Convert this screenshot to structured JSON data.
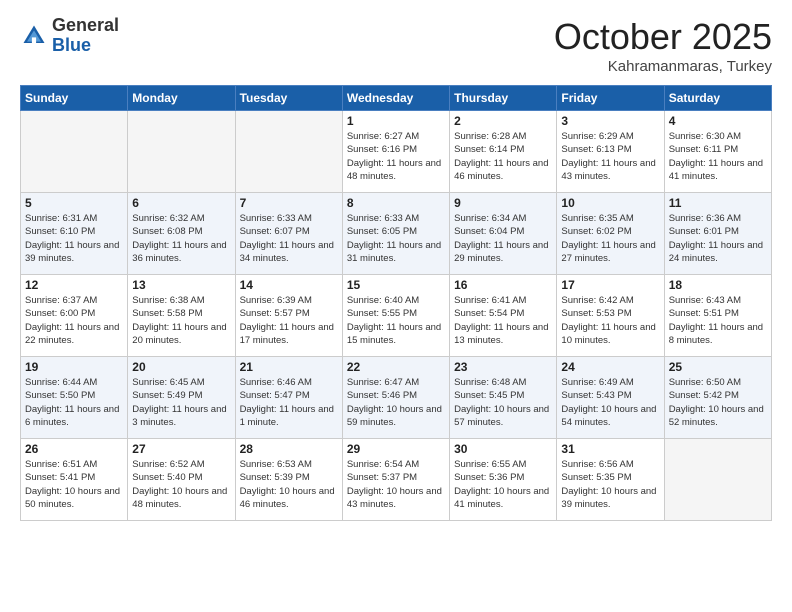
{
  "header": {
    "logo_general": "General",
    "logo_blue": "Blue",
    "month": "October 2025",
    "location": "Kahramanmaras, Turkey"
  },
  "weekdays": [
    "Sunday",
    "Monday",
    "Tuesday",
    "Wednesday",
    "Thursday",
    "Friday",
    "Saturday"
  ],
  "weeks": [
    [
      {
        "day": "",
        "empty": true
      },
      {
        "day": "",
        "empty": true
      },
      {
        "day": "",
        "empty": true
      },
      {
        "day": "1",
        "sunrise": "Sunrise: 6:27 AM",
        "sunset": "Sunset: 6:16 PM",
        "daylight": "Daylight: 11 hours and 48 minutes."
      },
      {
        "day": "2",
        "sunrise": "Sunrise: 6:28 AM",
        "sunset": "Sunset: 6:14 PM",
        "daylight": "Daylight: 11 hours and 46 minutes."
      },
      {
        "day": "3",
        "sunrise": "Sunrise: 6:29 AM",
        "sunset": "Sunset: 6:13 PM",
        "daylight": "Daylight: 11 hours and 43 minutes."
      },
      {
        "day": "4",
        "sunrise": "Sunrise: 6:30 AM",
        "sunset": "Sunset: 6:11 PM",
        "daylight": "Daylight: 11 hours and 41 minutes."
      }
    ],
    [
      {
        "day": "5",
        "sunrise": "Sunrise: 6:31 AM",
        "sunset": "Sunset: 6:10 PM",
        "daylight": "Daylight: 11 hours and 39 minutes."
      },
      {
        "day": "6",
        "sunrise": "Sunrise: 6:32 AM",
        "sunset": "Sunset: 6:08 PM",
        "daylight": "Daylight: 11 hours and 36 minutes."
      },
      {
        "day": "7",
        "sunrise": "Sunrise: 6:33 AM",
        "sunset": "Sunset: 6:07 PM",
        "daylight": "Daylight: 11 hours and 34 minutes."
      },
      {
        "day": "8",
        "sunrise": "Sunrise: 6:33 AM",
        "sunset": "Sunset: 6:05 PM",
        "daylight": "Daylight: 11 hours and 31 minutes."
      },
      {
        "day": "9",
        "sunrise": "Sunrise: 6:34 AM",
        "sunset": "Sunset: 6:04 PM",
        "daylight": "Daylight: 11 hours and 29 minutes."
      },
      {
        "day": "10",
        "sunrise": "Sunrise: 6:35 AM",
        "sunset": "Sunset: 6:02 PM",
        "daylight": "Daylight: 11 hours and 27 minutes."
      },
      {
        "day": "11",
        "sunrise": "Sunrise: 6:36 AM",
        "sunset": "Sunset: 6:01 PM",
        "daylight": "Daylight: 11 hours and 24 minutes."
      }
    ],
    [
      {
        "day": "12",
        "sunrise": "Sunrise: 6:37 AM",
        "sunset": "Sunset: 6:00 PM",
        "daylight": "Daylight: 11 hours and 22 minutes."
      },
      {
        "day": "13",
        "sunrise": "Sunrise: 6:38 AM",
        "sunset": "Sunset: 5:58 PM",
        "daylight": "Daylight: 11 hours and 20 minutes."
      },
      {
        "day": "14",
        "sunrise": "Sunrise: 6:39 AM",
        "sunset": "Sunset: 5:57 PM",
        "daylight": "Daylight: 11 hours and 17 minutes."
      },
      {
        "day": "15",
        "sunrise": "Sunrise: 6:40 AM",
        "sunset": "Sunset: 5:55 PM",
        "daylight": "Daylight: 11 hours and 15 minutes."
      },
      {
        "day": "16",
        "sunrise": "Sunrise: 6:41 AM",
        "sunset": "Sunset: 5:54 PM",
        "daylight": "Daylight: 11 hours and 13 minutes."
      },
      {
        "day": "17",
        "sunrise": "Sunrise: 6:42 AM",
        "sunset": "Sunset: 5:53 PM",
        "daylight": "Daylight: 11 hours and 10 minutes."
      },
      {
        "day": "18",
        "sunrise": "Sunrise: 6:43 AM",
        "sunset": "Sunset: 5:51 PM",
        "daylight": "Daylight: 11 hours and 8 minutes."
      }
    ],
    [
      {
        "day": "19",
        "sunrise": "Sunrise: 6:44 AM",
        "sunset": "Sunset: 5:50 PM",
        "daylight": "Daylight: 11 hours and 6 minutes."
      },
      {
        "day": "20",
        "sunrise": "Sunrise: 6:45 AM",
        "sunset": "Sunset: 5:49 PM",
        "daylight": "Daylight: 11 hours and 3 minutes."
      },
      {
        "day": "21",
        "sunrise": "Sunrise: 6:46 AM",
        "sunset": "Sunset: 5:47 PM",
        "daylight": "Daylight: 11 hours and 1 minute."
      },
      {
        "day": "22",
        "sunrise": "Sunrise: 6:47 AM",
        "sunset": "Sunset: 5:46 PM",
        "daylight": "Daylight: 10 hours and 59 minutes."
      },
      {
        "day": "23",
        "sunrise": "Sunrise: 6:48 AM",
        "sunset": "Sunset: 5:45 PM",
        "daylight": "Daylight: 10 hours and 57 minutes."
      },
      {
        "day": "24",
        "sunrise": "Sunrise: 6:49 AM",
        "sunset": "Sunset: 5:43 PM",
        "daylight": "Daylight: 10 hours and 54 minutes."
      },
      {
        "day": "25",
        "sunrise": "Sunrise: 6:50 AM",
        "sunset": "Sunset: 5:42 PM",
        "daylight": "Daylight: 10 hours and 52 minutes."
      }
    ],
    [
      {
        "day": "26",
        "sunrise": "Sunrise: 6:51 AM",
        "sunset": "Sunset: 5:41 PM",
        "daylight": "Daylight: 10 hours and 50 minutes."
      },
      {
        "day": "27",
        "sunrise": "Sunrise: 6:52 AM",
        "sunset": "Sunset: 5:40 PM",
        "daylight": "Daylight: 10 hours and 48 minutes."
      },
      {
        "day": "28",
        "sunrise": "Sunrise: 6:53 AM",
        "sunset": "Sunset: 5:39 PM",
        "daylight": "Daylight: 10 hours and 46 minutes."
      },
      {
        "day": "29",
        "sunrise": "Sunrise: 6:54 AM",
        "sunset": "Sunset: 5:37 PM",
        "daylight": "Daylight: 10 hours and 43 minutes."
      },
      {
        "day": "30",
        "sunrise": "Sunrise: 6:55 AM",
        "sunset": "Sunset: 5:36 PM",
        "daylight": "Daylight: 10 hours and 41 minutes."
      },
      {
        "day": "31",
        "sunrise": "Sunrise: 6:56 AM",
        "sunset": "Sunset: 5:35 PM",
        "daylight": "Daylight: 10 hours and 39 minutes."
      },
      {
        "day": "",
        "empty": true
      }
    ]
  ]
}
